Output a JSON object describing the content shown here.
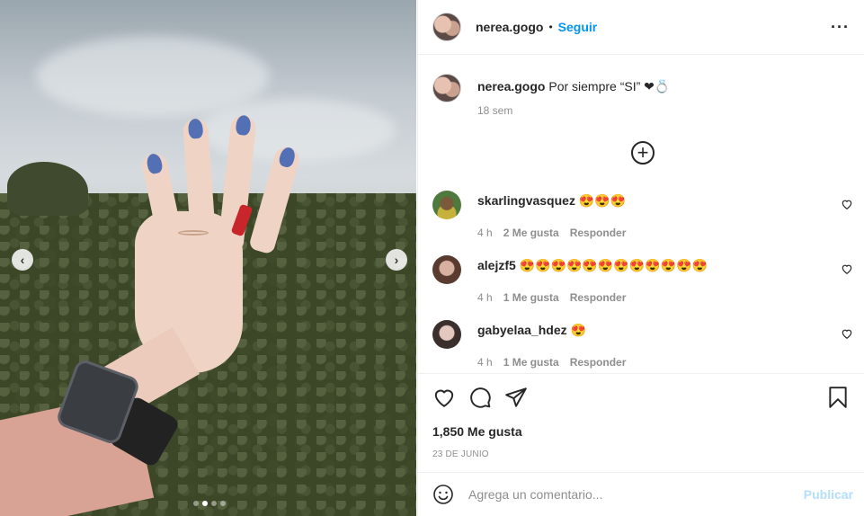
{
  "post": {
    "author": "nerea.gogo",
    "follow_label": "Seguir",
    "separator": "•",
    "caption": "Por siempre “SI” ❤💍",
    "caption_age": "18 sem",
    "likes": "1,850 Me gusta",
    "date": "23 DE JUNIO",
    "photo_count": 4,
    "active_photo": 2
  },
  "comments": [
    {
      "user": "skarlingvasquez",
      "text": "😍😍😍",
      "age": "4 h",
      "likes": "2 Me gusta",
      "reply_label": "Responder"
    },
    {
      "user": "alejzf5",
      "text": "😍😍😍😍😍😍😍😍😍😍😍😍",
      "age": "4 h",
      "likes": "1 Me gusta",
      "reply_label": "Responder"
    },
    {
      "user": "gabyelaa_hdez",
      "text": "😍",
      "age": "4 h",
      "likes": "1 Me gusta",
      "reply_label": "Responder"
    }
  ],
  "add_comment": {
    "placeholder": "Agrega un comentario...",
    "publish_label": "Publicar"
  },
  "icons": {
    "more": "more-options-icon",
    "load_more": "plus-circle-icon",
    "like": "heart-icon",
    "comment": "comment-icon",
    "share": "paper-plane-icon",
    "save": "bookmark-icon",
    "emoji": "smiley-icon",
    "prev": "chevron-left-icon",
    "next": "chevron-right-icon"
  },
  "colors": {
    "accent": "#0095f6",
    "publish_disabled": "#b2dffc",
    "muted": "#8e8e8e",
    "nail_polish": "#5270b3"
  }
}
